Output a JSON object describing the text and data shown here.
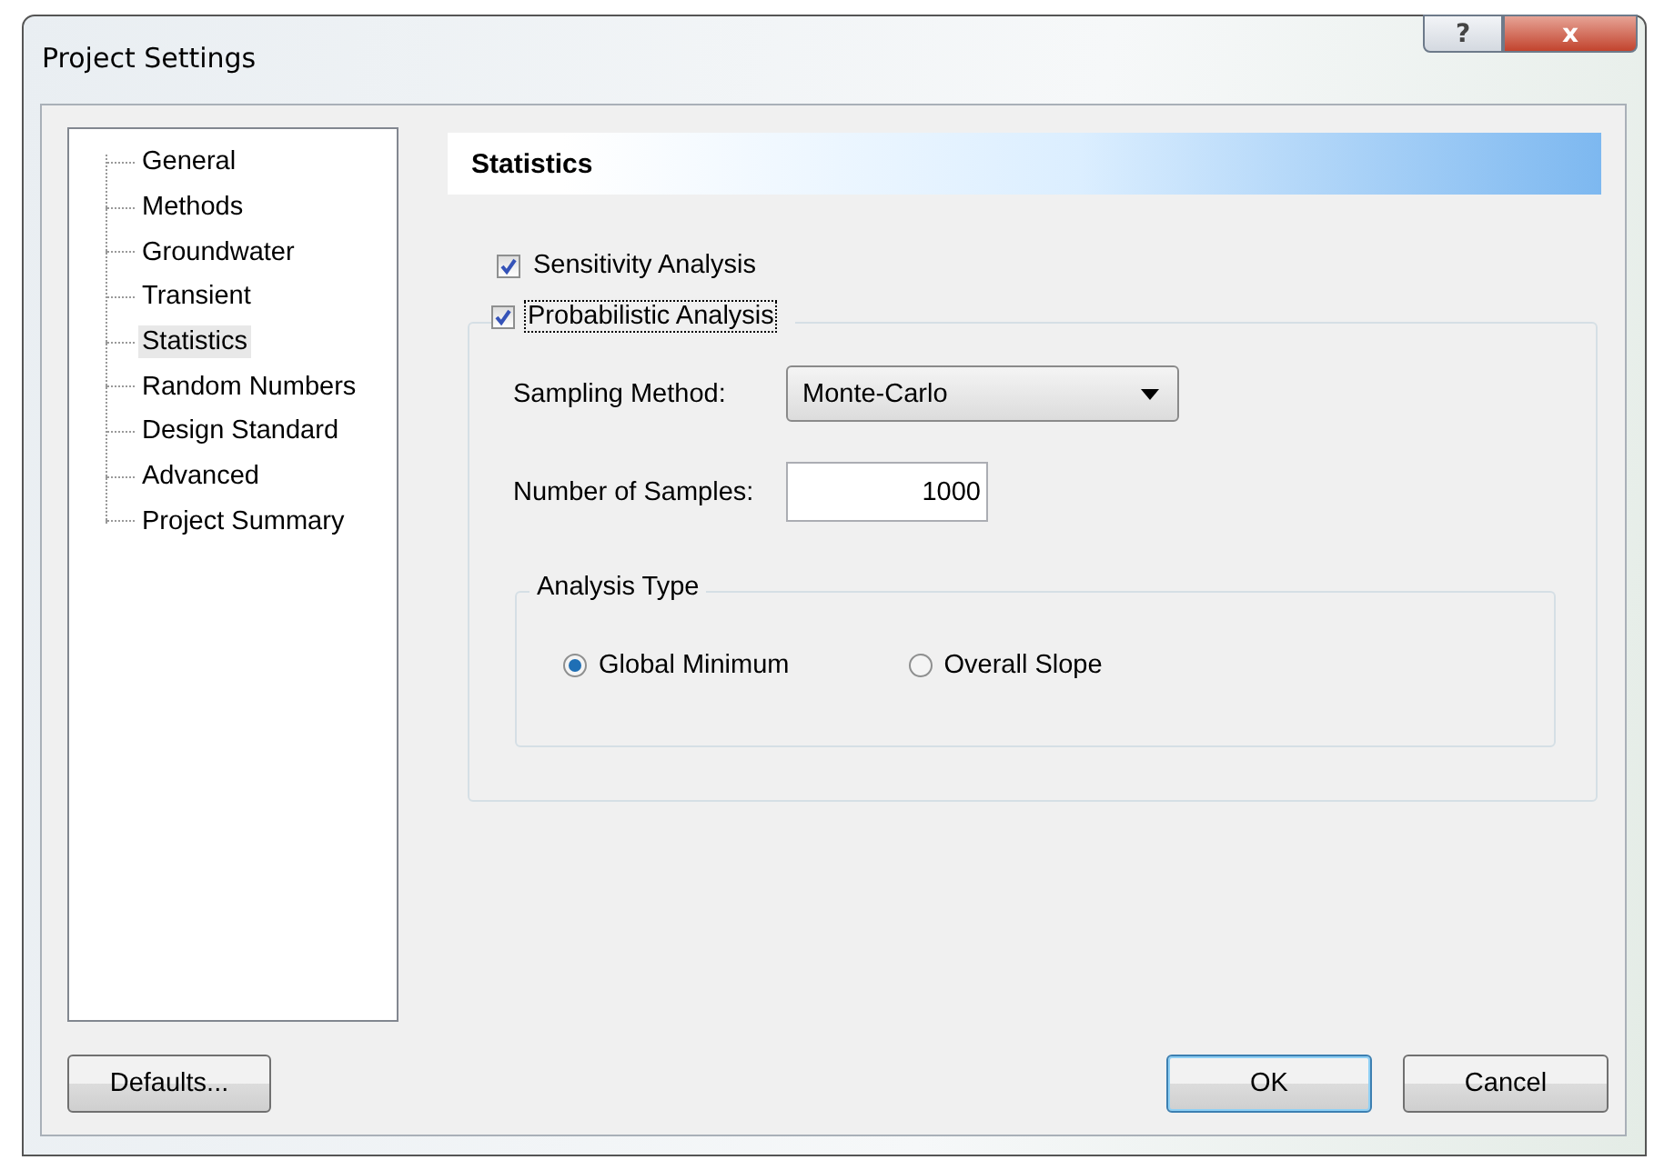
{
  "window": {
    "title": "Project Settings",
    "title_buttons": [
      {
        "kind": "help",
        "label": "?"
      },
      {
        "kind": "close",
        "label": "x"
      }
    ]
  },
  "sidebar": {
    "items": [
      {
        "label": "General",
        "selected": false
      },
      {
        "label": "Methods",
        "selected": false
      },
      {
        "label": "Groundwater",
        "selected": false
      },
      {
        "label": "Transient",
        "selected": false
      },
      {
        "label": "Statistics",
        "selected": true
      },
      {
        "label": "Random Numbers",
        "selected": false
      },
      {
        "label": "Design Standard",
        "selected": false
      },
      {
        "label": "Advanced",
        "selected": false
      },
      {
        "label": "Project Summary",
        "selected": false
      }
    ]
  },
  "panel": {
    "heading": "Statistics",
    "sensitivity": {
      "label": "Sensitivity Analysis",
      "checked": true
    },
    "probabilistic": {
      "label": "Probabilistic Analysis",
      "checked": true,
      "focused": true,
      "sampling_method": {
        "label": "Sampling Method:",
        "value": "Monte-Carlo"
      },
      "samples": {
        "label": "Number of Samples:",
        "value": "1000"
      },
      "analysis_type": {
        "legend": "Analysis Type",
        "options": [
          {
            "label": "Global Minimum",
            "selected": true
          },
          {
            "label": "Overall Slope",
            "selected": false
          }
        ]
      }
    }
  },
  "buttons": [
    {
      "label": "Defaults...",
      "default": false
    },
    {
      "label": "OK",
      "default": true
    },
    {
      "label": "Cancel",
      "default": false
    }
  ]
}
